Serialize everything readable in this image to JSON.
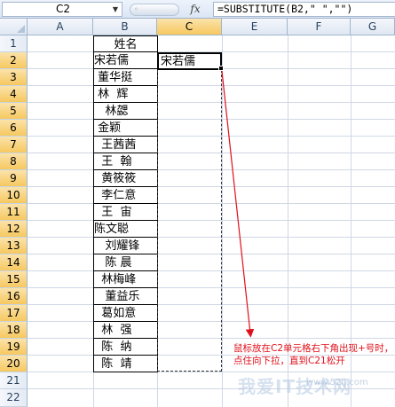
{
  "formula_bar": {
    "name_box": "C2",
    "fx_label": "fx",
    "formula": "=SUBSTITUTE(B2,\" \",\"\")"
  },
  "columns": [
    "A",
    "B",
    "C",
    "E",
    "F",
    "G"
  ],
  "rows": [
    "1",
    "2",
    "3",
    "4",
    "5",
    "6",
    "7",
    "8",
    "9",
    "10",
    "11",
    "12",
    "13",
    "14",
    "15",
    "16",
    "17",
    "18",
    "19",
    "20",
    "21",
    "22"
  ],
  "cells": {
    "B1": "姓名",
    "B2": "宋若儒",
    "B3": " 董华挺",
    "B4": " 林  辉",
    "B5": "   林勰",
    "B6": " 金颖",
    "B7": "  王茜茜",
    "B8": "  王  翰",
    "B9": "  黄筱筱",
    "B10": "  李仁意",
    "B11": "  王  宙",
    "B12": "陈文聪",
    "B13": "   刘耀锋",
    "B14": "   陈 晨",
    "B15": "  林梅峰",
    "B16": "   董益乐",
    "B17": "  葛如意",
    "B18": "  林  强",
    "B19": "  陈  纳",
    "B20": "  陈  靖",
    "C2": "宋若儒"
  },
  "annotation": "鼠标放在C2单元格右下角出现+号时，点住向下拉，直到C21松开",
  "watermark": "我爱IT技术网",
  "watermark_sub": "www.52ij.com",
  "colors": {
    "annotation": "#e0101a",
    "header_selected": "#f6c85f",
    "header": "#dfe7f2"
  }
}
